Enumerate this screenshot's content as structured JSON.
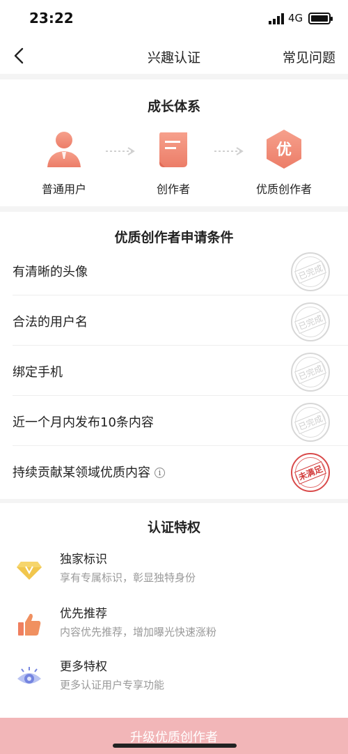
{
  "status_bar": {
    "time": "23:22",
    "network": "4G"
  },
  "nav": {
    "title": "兴趣认证",
    "faq": "常见问题"
  },
  "growth": {
    "title": "成长体系",
    "steps": [
      {
        "label": "普通用户",
        "icon": "user-icon"
      },
      {
        "label": "创作者",
        "icon": "document-icon"
      },
      {
        "label": "优质创作者",
        "icon": "hexagon-badge-icon",
        "badge_text": "优"
      }
    ]
  },
  "conditions": {
    "title": "优质创作者申请条件",
    "items": [
      {
        "label": "有清晰的头像",
        "status": "已完成"
      },
      {
        "label": "合法的用户名",
        "status": "已完成"
      },
      {
        "label": "绑定手机",
        "status": "已完成"
      },
      {
        "label": "近一个月内发布10条内容",
        "status": "已完成"
      },
      {
        "label": "持续贡献某领域优质内容",
        "status": "未满足",
        "info_icon": "i"
      }
    ]
  },
  "privileges": {
    "title": "认证特权",
    "items": [
      {
        "name": "独家标识",
        "desc": "享有专属标识，彰显独特身份",
        "icon": "diamond-v-icon"
      },
      {
        "name": "优先推荐",
        "desc": "内容优先推荐，增加曝光快速涨粉",
        "icon": "thumbs-up-icon"
      },
      {
        "name": "更多特权",
        "desc": "更多认证用户专享功能",
        "icon": "eye-icon"
      }
    ]
  },
  "bottom": {
    "button_label": "升级优质创作者"
  },
  "colors": {
    "accent": "#ef8a73",
    "stamp_done": "#d4d4d4",
    "stamp_fail": "#d23a3a",
    "button_bg": "#f2b6b8"
  }
}
